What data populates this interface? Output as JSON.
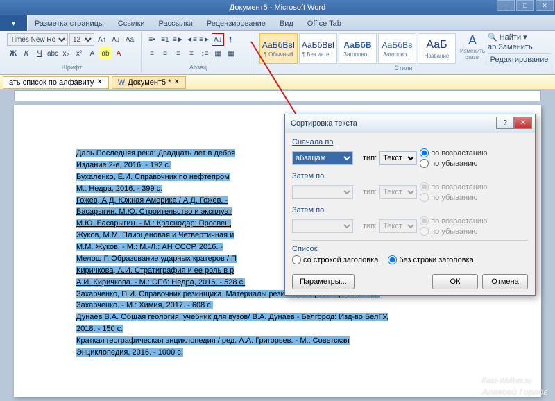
{
  "app": {
    "title": "Документ5 - Microsoft Word"
  },
  "ribbon_tabs": [
    "Разметка страницы",
    "Ссылки",
    "Рассылки",
    "Рецензирование",
    "Вид",
    "Office Tab"
  ],
  "font": {
    "family": "Times New Ro",
    "size": "12"
  },
  "groups": {
    "font": "Шрифт",
    "para": "Абзац",
    "styles": "Стили"
  },
  "styles": [
    {
      "prev": "АаБбВвІ",
      "name": "¶ Обычный"
    },
    {
      "prev": "АаБбВвІ",
      "name": "¶ Без инте..."
    },
    {
      "prev": "АаБбВ",
      "name": "Заголово..."
    },
    {
      "prev": "АаБбВв",
      "name": "Заголово..."
    },
    {
      "prev": "АаБ",
      "name": "Название"
    }
  ],
  "change_styles": "Изменить стили",
  "editing": {
    "find": "Найти",
    "replace": "Заменить",
    "select": "Редактирование"
  },
  "subtab_left": "ать список по алфавиту",
  "subtab_doc": "Документ5 *",
  "doc": [
    "Даль Последняя река: Двадцать лет в дебря",
    "Издание 2-е, 2016. - 192 с.",
    "Бухаленко, Е.И. Справочник по нефтепром",
    "М.: Недра, 2016. - 399 с.",
    "Гожев, А.Д. Южная Америка / А.Д. Гожев. -",
    "Басарыгин, М.Ю. Строительство и эксплуат",
    "М.Ю. Басарыгин. - М.: Краснодар: Просвещ",
    "Жуков, М.М. Плиоценовая и Четвертичная и",
    "М.М. Жуков. - М.: М.-Л.: АН СССР, 2016. -",
    "Мелош Г. Образование ударных кратеров / П",
    "Киричкова, А.И. Стратиграфия и ее роль в р",
    "А.И. Киричкова. - М.: СПб: Недра, 2016. - 528 с.",
    "Захарченко, П.И. Справочник резинщика. Материалы резинового производства / П.И.",
    "Захарченко. - М.: Химия, 2017. - 608 с.",
    "Дунаев В.А. Общая геология: учебник для вузов/ В.А. Дунаев - Белгород: Изд-во БелГУ,",
    "2018. - 150 с.",
    "Краткая географическая энциклопедия / ред. А.А. Григорьев. - М.: Советская",
    "Энциклопедия, 2016. - 1000 с."
  ],
  "dialog": {
    "title": "Сортировка текста",
    "first": "Сначала по",
    "then": "Затем по",
    "sel_para": "абзацам",
    "type_lbl": "тип:",
    "type_text": "Текст",
    "asc": "по возрастанию",
    "desc": "по убыванию",
    "list": "Список",
    "with_hdr": "со строкой заголовка",
    "no_hdr": "без строки заголовка",
    "params": "Параметры...",
    "ok": "ОК",
    "cancel": "Отмена"
  },
  "wm": {
    "l1": "Fast-Wolker.ru",
    "l2": "Алексей Горлов"
  }
}
